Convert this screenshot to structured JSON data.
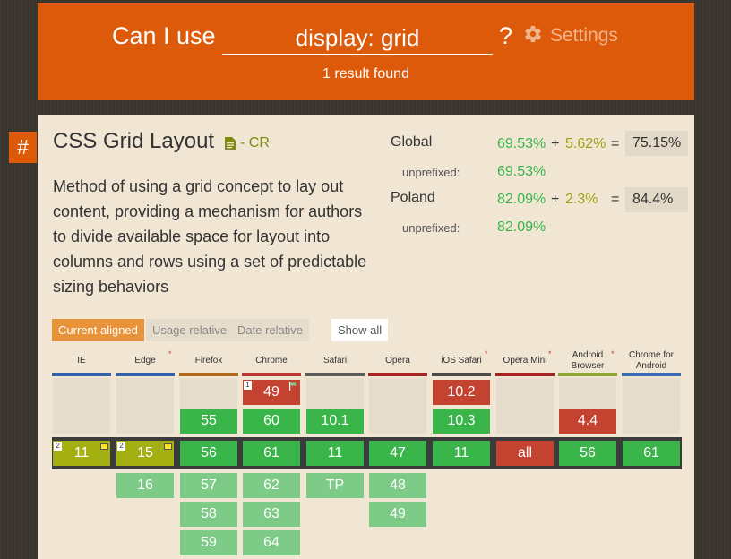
{
  "header": {
    "lead": "Can I use",
    "query": "display: grid",
    "qmark": "?",
    "settings_label": "Settings",
    "results": "1 result found"
  },
  "feature": {
    "hash": "#",
    "title": "CSS Grid Layout",
    "status": "- CR",
    "description": "Method of using a grid concept to lay out content, providing a mechanism for authors to divide available space for layout into columns and rows using a set of predictable sizing behaviors"
  },
  "stats": {
    "global": {
      "label": "Global",
      "full": "69.53%",
      "plus": "+",
      "partial": "5.62%",
      "eq": "=",
      "total": "75.15%",
      "unprefixed_label": "unprefixed:",
      "unprefixed": "69.53%"
    },
    "region": {
      "label": "Poland",
      "full": "82.09%",
      "plus": "+",
      "partial": "2.3%",
      "eq": "=",
      "total": "84.4%",
      "unprefixed_label": "unprefixed:",
      "unprefixed": "82.09%"
    }
  },
  "view_buttons": {
    "current": "Current aligned",
    "usage": "Usage relative",
    "date": "Date relative",
    "show_all": "Show all"
  },
  "browsers": [
    {
      "name": "IE",
      "star": ""
    },
    {
      "name": "Edge",
      "star": "*"
    },
    {
      "name": "Firefox",
      "star": ""
    },
    {
      "name": "Chrome",
      "star": ""
    },
    {
      "name": "Safari",
      "star": ""
    },
    {
      "name": "Opera",
      "star": ""
    },
    {
      "name": "iOS Safari",
      "star": "*"
    },
    {
      "name": "Opera Mini",
      "star": "*"
    },
    {
      "name": "Android Browser",
      "star": "*"
    },
    {
      "name": "Chrome for Android",
      "star": ""
    }
  ],
  "versions": {
    "row_past2": [
      "",
      "",
      "",
      "49",
      "",
      "",
      "10.2",
      "",
      "",
      ""
    ],
    "row_past1": [
      "",
      "",
      "55",
      "60",
      "10.1",
      "",
      "10.3",
      "",
      "4.4",
      ""
    ],
    "row_current": [
      "11",
      "15",
      "56",
      "61",
      "11",
      "47",
      "11",
      "all",
      "56",
      "61"
    ],
    "row_future1": [
      "",
      "16",
      "57",
      "62",
      "TP",
      "48",
      "",
      "",
      "",
      ""
    ],
    "row_future2": [
      "",
      "",
      "58",
      "63",
      "",
      "49",
      "",
      "",
      "",
      ""
    ],
    "row_future3": [
      "",
      "",
      "59",
      "64",
      "",
      "",
      "",
      "",
      "",
      ""
    ]
  },
  "notes": {
    "chrome49": "1",
    "ie11": "2",
    "edge15": "2"
  },
  "colors": {
    "supported": "#39b54a",
    "future_supported": "#7dcb86",
    "unsupported": "#c44230",
    "partial": "#a4b012",
    "accent": "#dd5a0a"
  }
}
